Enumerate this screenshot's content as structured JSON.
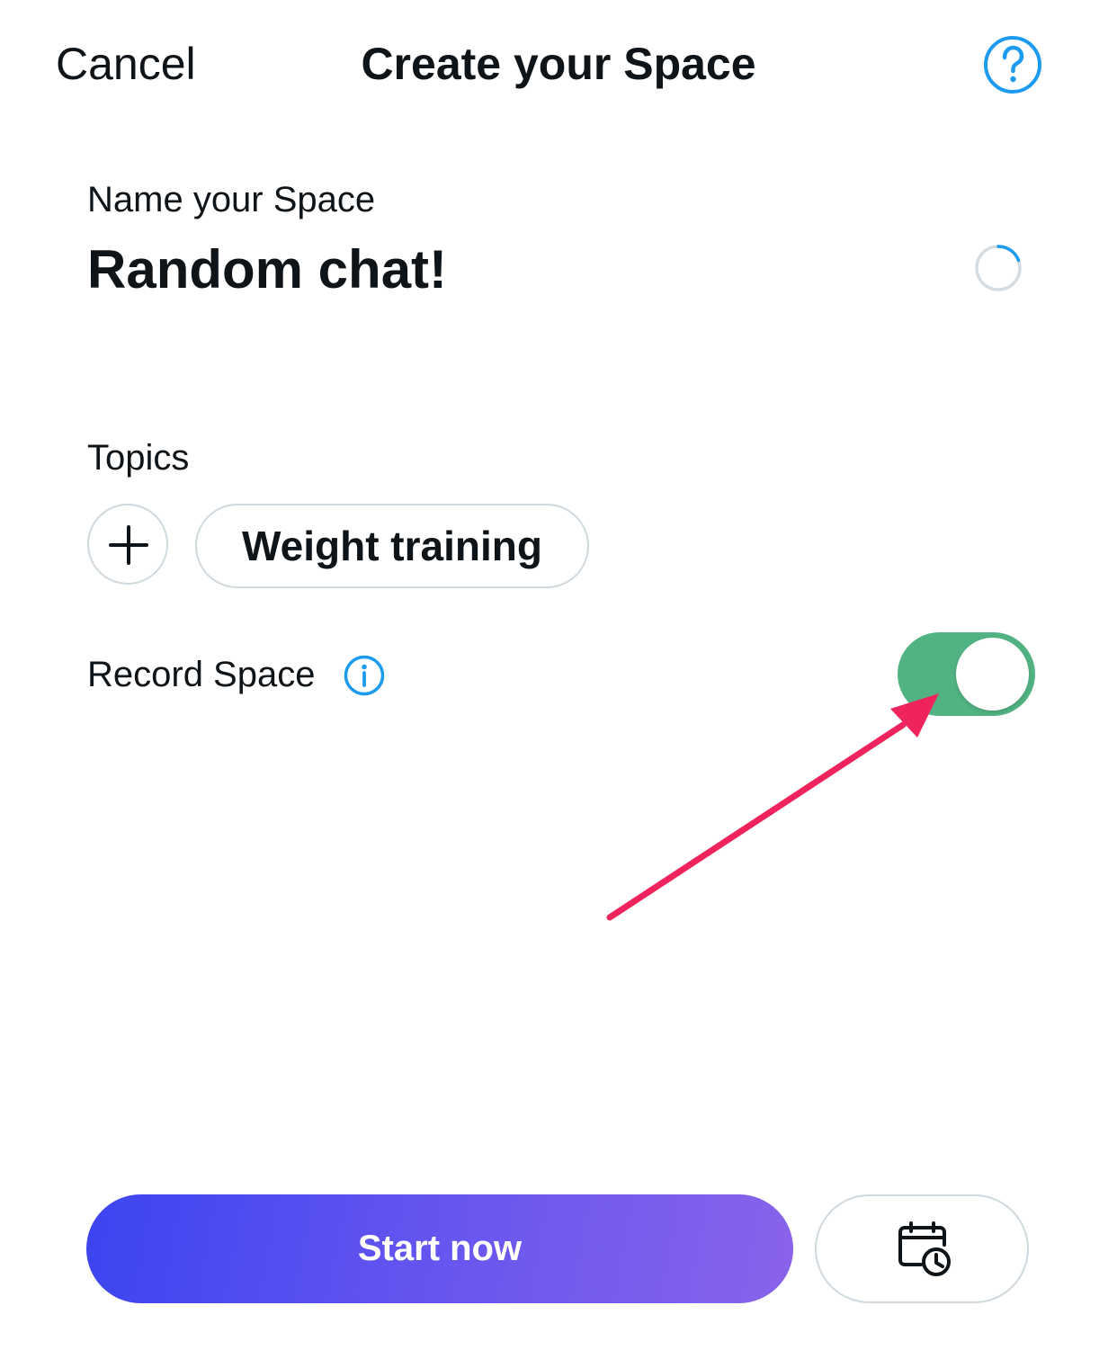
{
  "header": {
    "cancel_label": "Cancel",
    "title": "Create your Space",
    "help_icon": "question-circle-icon"
  },
  "space_name": {
    "label": "Name your Space",
    "value": "Random chat!"
  },
  "topics": {
    "label": "Topics",
    "add_icon": "plus-icon",
    "selected": [
      "Weight training"
    ]
  },
  "record": {
    "label": "Record Space",
    "info_icon": "info-circle-icon",
    "enabled": true
  },
  "footer": {
    "start_label": "Start now",
    "schedule_icon": "calendar-clock-icon"
  },
  "colors": {
    "accent_blue": "#1d9bf0",
    "toggle_on": "#52b382",
    "start_gradient_from": "#3c44f0",
    "start_gradient_to": "#8a63ea",
    "annotation_arrow": "#f0245c"
  }
}
